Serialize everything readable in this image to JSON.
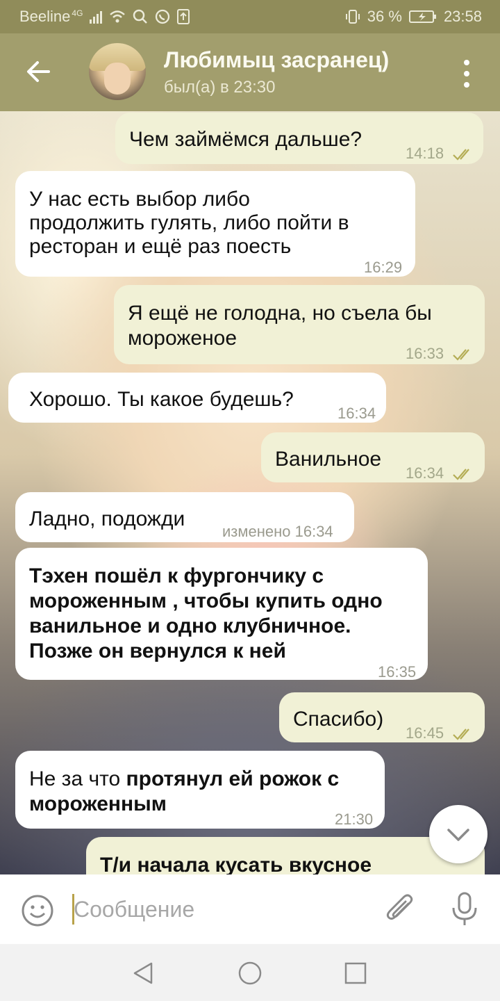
{
  "status": {
    "carrier": "Beeline",
    "network": "4G",
    "battery": "36 %",
    "time": "23:58"
  },
  "header": {
    "title": "Любимыц засранец)",
    "subtitle": "был(а) в 23:30"
  },
  "messages": [
    {
      "dir": "out",
      "lines": [
        "Чем займёмся дальше?"
      ],
      "time": "14:18",
      "read": true
    },
    {
      "dir": "in",
      "lines": [
        "У нас есть выбор либо",
        "продолжить гулять, либо пойти в",
        "ресторан и ещё раз поесть"
      ],
      "time": "16:29"
    },
    {
      "dir": "out",
      "lines": [
        "Я ещё не голодна, но съела бы",
        "мороженое"
      ],
      "time": "16:33",
      "read": true
    },
    {
      "dir": "in",
      "lines": [
        "Хорошо. Ты какое будешь?"
      ],
      "time": "16:34"
    },
    {
      "dir": "out",
      "lines": [
        "Ванильное"
      ],
      "time": "16:34",
      "read": true
    },
    {
      "dir": "in",
      "lines": [
        "Ладно, подожди"
      ],
      "time": "изменено 16:34"
    },
    {
      "dir": "in",
      "lines": [
        "Тэхен пошёл к фургончику с",
        "мороженным , чтобы купить одно",
        "ванильное и одно клубничное.",
        "Позже он вернулся к ней"
      ],
      "time": "16:35",
      "bold": true
    },
    {
      "dir": "out",
      "lines": [
        "Спасибо)"
      ],
      "time": "16:45",
      "read": true
    },
    {
      "dir": "in",
      "line1_normal": "Не за что ",
      "line1_bold": "протянул ей рожок с",
      "line2_bold": "мороженным",
      "time": "21:30"
    },
    {
      "dir": "out",
      "lines": [
        "Т/и начала кусать вкусное"
      ]
    }
  ],
  "input": {
    "placeholder": "Сообщение"
  },
  "colors": {
    "header": "#a29e6d",
    "statusbar": "#908c5a",
    "bubble_out": "#f1f1d6",
    "bubble_in": "#ffffff",
    "read_check": "#b4ad55"
  }
}
